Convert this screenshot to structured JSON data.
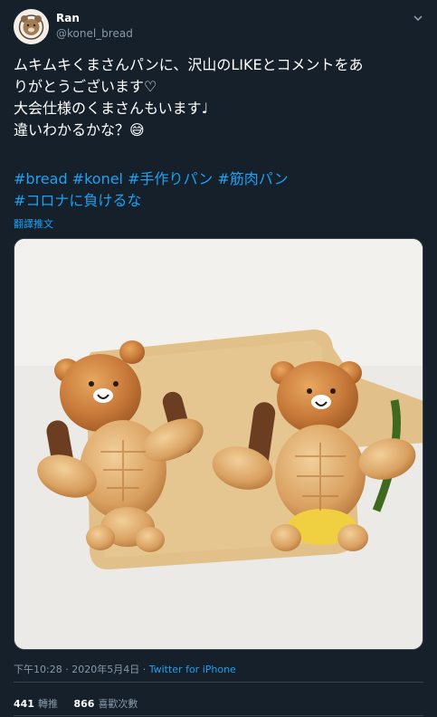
{
  "author": {
    "display_name": "Ran",
    "handle": "@konel_bread",
    "avatar_icon": "bear-avatar-icon"
  },
  "tweet": {
    "lines": [
      "ムキムキくまさんパンに、沢山のLIKEとコメントをあ",
      "りがとうございます♡",
      "大会仕様のくまさんもいます♩",
      "違いわかるかな？😅"
    ],
    "hashtags_line1": "#bread #konel #手作りパン #筋肉パン",
    "hashtags_line2": "#コロナに負けるな",
    "translate_label": "翻譯推文"
  },
  "meta": {
    "time": "下午10:28",
    "separator": " · ",
    "date": "2020年5月4日",
    "source": "Twitter for iPhone"
  },
  "stats": {
    "retweets_count": "441",
    "retweets_label": "轉推",
    "likes_count": "866",
    "likes_label": "喜歡次數"
  },
  "colors": {
    "background": "#15202b",
    "link": "#1da1f2",
    "secondary_text": "#8899a6",
    "divider": "#38444d"
  }
}
